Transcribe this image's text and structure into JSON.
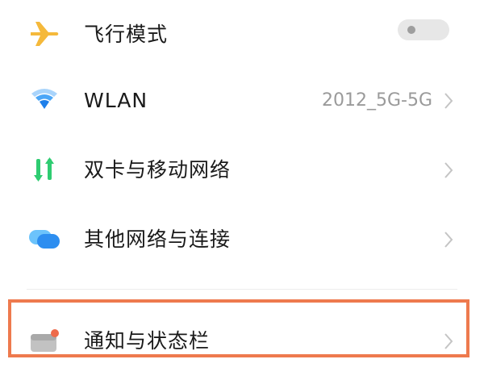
{
  "settings": {
    "items": [
      {
        "label": "飞行模式",
        "icon": "airplane-icon",
        "icon_color": "#f5b93b",
        "control": "toggle",
        "toggle_on": false
      },
      {
        "label": "WLAN",
        "icon": "wifi-icon",
        "icon_color": "#2a8bf2",
        "value": "2012_5G-5G",
        "control": "chevron"
      },
      {
        "label": "双卡与移动网络",
        "icon": "mobile-network-icon",
        "icon_color": "#2ecc71",
        "control": "chevron"
      },
      {
        "label": "其他网络与连接",
        "icon": "other-networks-icon",
        "icon_color": "#2d9cf0",
        "control": "chevron"
      },
      {
        "label": "通知与状态栏",
        "icon": "notification-icon",
        "icon_color": "#b5b5b5",
        "badge_color": "#ee6a4a",
        "control": "chevron",
        "highlighted": true
      }
    ]
  },
  "colors": {
    "highlight_frame": "#ee7a4e",
    "value_text": "#9a9a9a",
    "chevron": "#c4c4c4"
  }
}
